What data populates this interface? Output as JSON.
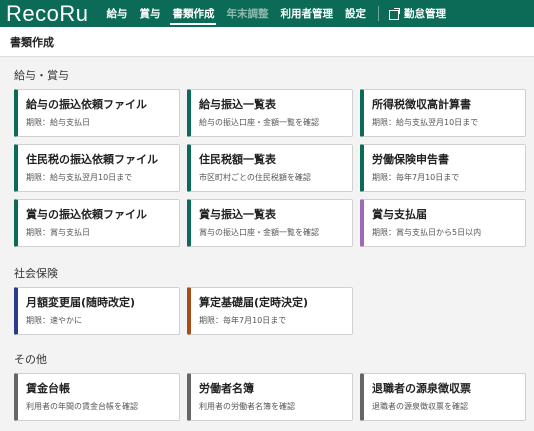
{
  "app": {
    "logo": "RecoRu"
  },
  "nav": {
    "items": [
      {
        "label": "給与",
        "state": "normal"
      },
      {
        "label": "賞与",
        "state": "normal"
      },
      {
        "label": "書類作成",
        "state": "active"
      },
      {
        "label": "年末調整",
        "state": "disabled"
      },
      {
        "label": "利用者管理",
        "state": "normal"
      },
      {
        "label": "設定",
        "state": "normal"
      }
    ],
    "attendance": "勤怠管理"
  },
  "page": {
    "title": "書類作成"
  },
  "sections": [
    {
      "title": "給与・賞与",
      "cards": [
        {
          "title": "給与の振込依頼ファイル",
          "sub": "期限：給与支払日",
          "color": "#0b6b57"
        },
        {
          "title": "給与振込一覧表",
          "sub": "給与の振込口座・金額一覧を確認",
          "color": "#0b6b57"
        },
        {
          "title": "所得税徴収高計算書",
          "sub": "期限：給与支払翌月10日まで",
          "color": "#0b6b57"
        },
        {
          "title": "住民税の振込依頼ファイル",
          "sub": "期限：給与支払翌月10日まで",
          "color": "#0b6b57"
        },
        {
          "title": "住民税額一覧表",
          "sub": "市区町村ごとの住民税額を確認",
          "color": "#0b6b57"
        },
        {
          "title": "労働保険申告書",
          "sub": "期限：毎年7月10日まで",
          "color": "#0b6b57"
        },
        {
          "title": "賞与の振込依頼ファイル",
          "sub": "期限：賞与支払日",
          "color": "#0b6b57"
        },
        {
          "title": "賞与振込一覧表",
          "sub": "賞与の振込口座・金額一覧を確認",
          "color": "#0b6b57"
        },
        {
          "title": "賞与支払届",
          "sub": "期限：賞与支払日から5日以内",
          "color": "#9b6bb8"
        }
      ]
    },
    {
      "title": "社会保険",
      "cards": [
        {
          "title": "月額変更届(随時改定)",
          "sub": "期限：速やかに",
          "color": "#2c3a8c"
        },
        {
          "title": "算定基礎届(定時決定)",
          "sub": "期限：毎年7月10日まで",
          "color": "#a64d1a"
        }
      ]
    },
    {
      "title": "その他",
      "cards": [
        {
          "title": "賃金台帳",
          "sub": "利用者の年間の賃金台帳を確認",
          "color": "#666666"
        },
        {
          "title": "労働者名簿",
          "sub": "利用者の労働者名簿を確認",
          "color": "#666666"
        },
        {
          "title": "退職者の源泉徴収票",
          "sub": "退職者の源泉徴収票を確認",
          "color": "#666666"
        }
      ]
    }
  ]
}
